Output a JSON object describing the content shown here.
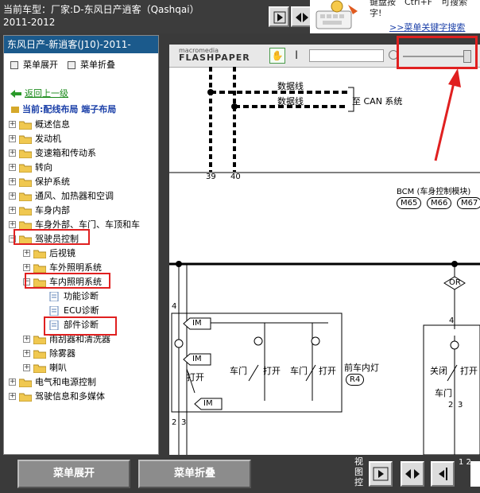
{
  "header": {
    "title_line1": "当前车型：厂家:D-东风日产逍客（Qashqai）",
    "title_line2": "2011-2012"
  },
  "keyboard_tip": {
    "text1": "键盘按　Ctrl+F　可搜索",
    "text2": "字!",
    "link": ">>菜单关键字搜索"
  },
  "sidebar": {
    "header": "东风日产-新逍客(J10)-2011-",
    "expand_label": "菜单展开",
    "collapse_label": "菜单折叠",
    "back_label": "返回上一级",
    "current_label": "当前:配线布局 端子布局",
    "items": [
      {
        "label": "概述信息"
      },
      {
        "label": "发动机"
      },
      {
        "label": "变速箱和传动系"
      },
      {
        "label": "转向"
      },
      {
        "label": "保护系统"
      },
      {
        "label": "通风、加热器和空调"
      },
      {
        "label": "车身内部"
      },
      {
        "label": "车身外部、车门、车顶和车"
      },
      {
        "label": "驾驶员控制"
      },
      {
        "label": "后视镜"
      },
      {
        "label": "车外照明系统"
      },
      {
        "label": "车内照明系统"
      },
      {
        "label": "功能诊断"
      },
      {
        "label": "ECU诊断"
      },
      {
        "label": "部件诊断"
      },
      {
        "label": "雨刮器和清洗器"
      },
      {
        "label": "除雾器"
      },
      {
        "label": "喇叭"
      },
      {
        "label": "电气和电源控制"
      },
      {
        "label": "驾驶信息和多媒体"
      }
    ]
  },
  "viewer": {
    "logo_top": "macromedia",
    "logo_main": "FLASHPAPER",
    "diagram": {
      "data_line_1": "数据线",
      "data_line_2": "数据线",
      "to_can": "至 CAN 系统",
      "pin_39": "39",
      "pin_40": "40",
      "bcm_label": "BCM (车身控制模块)",
      "m65": "M65",
      "m66": "M66",
      "m67": "M67",
      "or_label": "OR",
      "im1": "IM",
      "im2": "IM",
      "im3": "IM",
      "num_4a": "4",
      "num_4b": "4",
      "open1": "打开",
      "door1": "车门",
      "open2": "打开",
      "door2": "车门",
      "open3": "打开",
      "front_lamp": "前车内灯",
      "r4": "R4",
      "close": "关闭",
      "open4": "打开",
      "door3": "车门",
      "n2": "2",
      "n3": "3",
      "n2b": "2",
      "n3b": "3"
    }
  },
  "bottom": {
    "expand_label": "菜单展开",
    "collapse_label": "菜单折叠",
    "view_label": "视图控",
    "page_num": "1 2"
  }
}
